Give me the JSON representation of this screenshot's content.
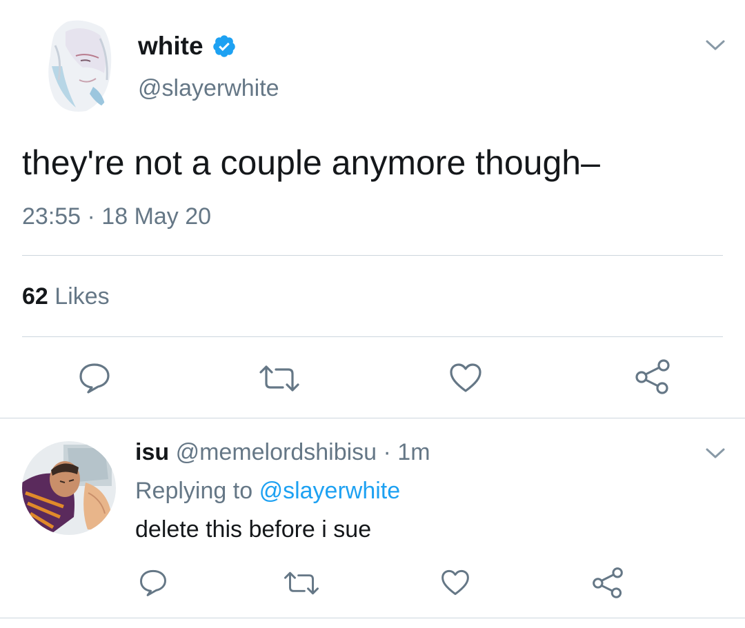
{
  "main_tweet": {
    "author": {
      "name": "white",
      "handle": "@slayerwhite",
      "verified": true,
      "avatar": "anime-character-avatar"
    },
    "text": "they're not a couple anymore though–",
    "timestamp": "23:55 · 18 May 20",
    "likes_count": "62",
    "likes_label": "Likes",
    "actions": [
      "reply-icon",
      "retweet-icon",
      "like-icon",
      "share-icon"
    ]
  },
  "reply_tweet": {
    "author": {
      "name": "isu",
      "handle_and_time": "@memelordshibisu · 1m",
      "avatar": "anime-character-avatar"
    },
    "replying_prefix": "Replying to",
    "replying_to": "@slayerwhite",
    "text": "delete this before i sue",
    "actions": [
      "reply-icon",
      "retweet-icon",
      "like-icon",
      "share-icon"
    ]
  },
  "colors": {
    "text_primary": "#14171a",
    "text_secondary": "#657786",
    "link": "#1da1f2",
    "divider": "#ccd6dd",
    "verified_badge": "#1da1f2"
  }
}
